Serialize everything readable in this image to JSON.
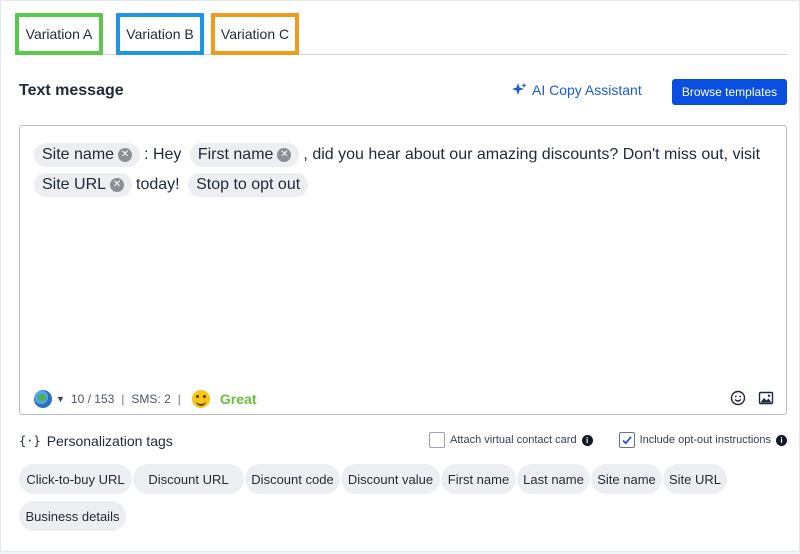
{
  "tabs": [
    {
      "label": "Variation A"
    },
    {
      "label": "Variation B"
    },
    {
      "label": "Variation C"
    }
  ],
  "header": {
    "title": "Text message",
    "ai_assistant_label": "AI Copy Assistant",
    "browse_templates_label": "Browse templates"
  },
  "message": {
    "chip_site_name": "Site name",
    "text_hey": ": Hey",
    "chip_first_name": "First name",
    "text_body": ", did you hear about our amazing discounts? Don't miss out, visit",
    "chip_site_url": "Site URL",
    "text_today": "today!",
    "chip_opt_out": "Stop to opt out"
  },
  "footer": {
    "char_count": "10 / 153",
    "sms_count": "SMS: 2",
    "quality": "Great",
    "separator": "|"
  },
  "personalization": {
    "title": "Personalization tags",
    "attach_card_label": "Attach virtual contact card",
    "attach_card_checked": false,
    "opt_out_label": "Include opt-out instructions",
    "opt_out_checked": true,
    "tags": [
      "Click-to-buy URL",
      "Discount URL",
      "Discount code",
      "Discount value",
      "First name",
      "Last name",
      "Site name",
      "Site URL",
      "Business details"
    ]
  },
  "colors": {
    "tab_a_border": "#5ac84a",
    "tab_b_border": "#1f95e6",
    "tab_c_border": "#ef9a1b",
    "primary": "#0a4fe0",
    "link": "#1d5bd6",
    "great": "#6cbf3a"
  },
  "icons": {
    "ai_assistant": "sparkle-icon",
    "remove_chip": "close-circle-icon",
    "language": "globe-icon",
    "emoji_face": "smiley-icon",
    "emoji_picker": "emoji-icon",
    "image": "image-icon",
    "personalization": "curly-brace-icon",
    "info": "info-icon",
    "check": "check-icon"
  }
}
